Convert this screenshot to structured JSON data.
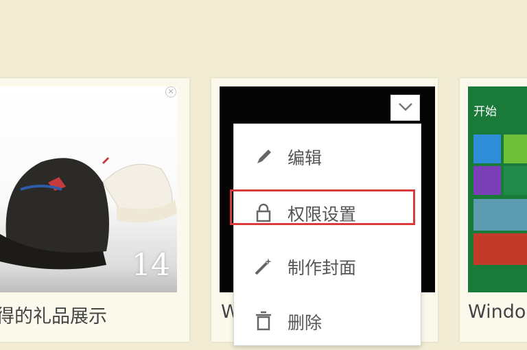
{
  "cards": [
    {
      "caption": "得的礼品展示",
      "photo_count": "14",
      "close_glyph": "✕"
    },
    {
      "caption": "W"
    },
    {
      "caption": "Windo",
      "start_label": "开始"
    }
  ],
  "menu": {
    "items": [
      {
        "label": "编辑",
        "icon": "pencil-icon"
      },
      {
        "label": "权限设置",
        "icon": "lock-icon",
        "selected": true
      },
      {
        "label": "制作封面",
        "icon": "magic-wand-icon"
      },
      {
        "label": "删除",
        "icon": "trash-icon"
      }
    ]
  },
  "colors": {
    "background": "#f1ecd3",
    "highlight": "#d93a3a",
    "tile_green": "#1a7a3a"
  }
}
